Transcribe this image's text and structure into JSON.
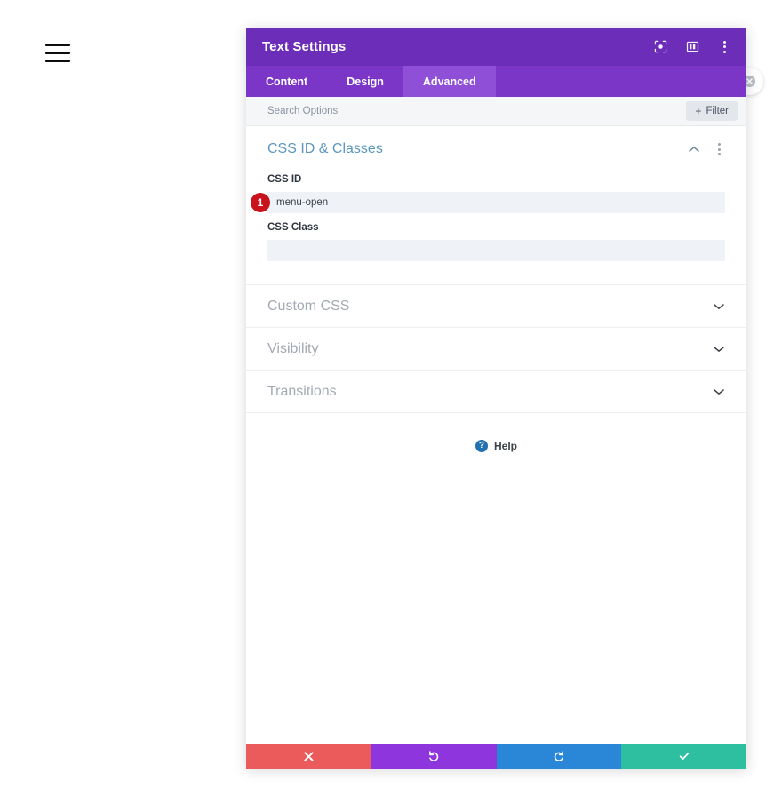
{
  "canvas": {
    "hamburger_menu_name": "hamburger-menu",
    "close_bubble_name": "close-modal-bubble"
  },
  "modal": {
    "title": "Text Settings",
    "header_icons": [
      {
        "name": "focus-mode-icon",
        "label": "Focus Mode"
      },
      {
        "name": "layout-columns-icon",
        "label": "Layout View"
      },
      {
        "name": "more-options-icon",
        "label": "More Options"
      }
    ],
    "tabs": [
      {
        "label": "Content",
        "active": false
      },
      {
        "label": "Design",
        "active": false
      },
      {
        "label": "Advanced",
        "active": true
      }
    ],
    "search": {
      "placeholder": "Search Options",
      "value": ""
    },
    "filter": {
      "label": "Filter",
      "plus": "+"
    },
    "sections": {
      "open": {
        "title": "CSS ID & Classes",
        "fields": [
          {
            "label": "CSS ID",
            "value": "menu-open",
            "placeholder": "",
            "badge": "1"
          },
          {
            "label": "CSS Class",
            "value": "",
            "placeholder": "",
            "badge": ""
          }
        ]
      },
      "closed": [
        {
          "title": "Custom CSS"
        },
        {
          "title": "Visibility"
        },
        {
          "title": "Transitions"
        }
      ]
    },
    "help": {
      "icon_glyph": "?",
      "label": "Help"
    },
    "footer_buttons": [
      {
        "name": "cancel-button",
        "icon": "close-icon",
        "color": "#eb5b5b"
      },
      {
        "name": "undo-button",
        "icon": "undo-icon",
        "color": "#8e35dd"
      },
      {
        "name": "redo-button",
        "icon": "redo-icon",
        "color": "#2a87d8"
      },
      {
        "name": "save-button",
        "icon": "checkmark-icon",
        "color": "#2dbfa0"
      }
    ]
  },
  "colors": {
    "header_purple": "#6c2eb9",
    "tabs_purple": "#7b36c7",
    "tab_active_purple": "#8f4fd6",
    "section_open_title": "#5c97bf",
    "badge_red": "#c9121b",
    "help_blue": "#2271b1"
  }
}
